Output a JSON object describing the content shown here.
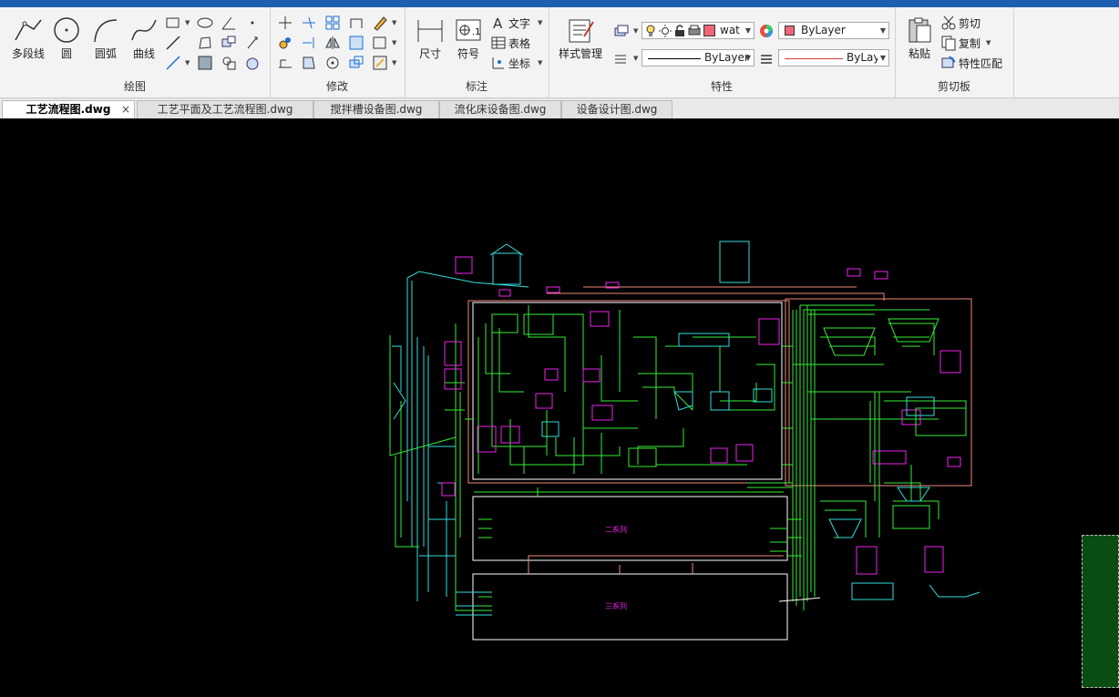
{
  "ribbon": {
    "groups": {
      "draw": {
        "label": "绘图",
        "polyline": "多段线",
        "circle": "圆",
        "arc": "圆弧",
        "curve": "曲线"
      },
      "modify": {
        "label": "修改"
      },
      "annotate": {
        "label": "标注",
        "dimension": "尺寸",
        "symbol": "符号",
        "text": "文字",
        "table": "表格",
        "coordinate": "坐标"
      },
      "properties": {
        "label": "特性",
        "style_manager": "样式管理",
        "layer_name": "wat",
        "color_value": "ByLayer",
        "linetype_value": "ByLayer",
        "lineweight_value": "ByLayer"
      },
      "clipboard": {
        "label": "剪切板",
        "paste": "粘贴",
        "cut": "剪切",
        "copy": "复制",
        "match_properties": "特性匹配"
      }
    }
  },
  "tabs": [
    {
      "label": "工艺流程图.dwg",
      "active": true,
      "close": "×"
    },
    {
      "label": "工艺平面及工艺流程图.dwg",
      "active": false
    },
    {
      "label": "搅拌槽设备图.dwg",
      "active": false
    },
    {
      "label": "流化床设备图.dwg",
      "active": false
    },
    {
      "label": "设备设计图.dwg",
      "active": false
    }
  ],
  "drawing": {
    "series_2_label": "二系列",
    "series_3_label": "三系列"
  },
  "colors": {
    "canvas_bg": "#000000",
    "green_line": "#33ee33",
    "magenta": "#ee22ee",
    "cyan": "#33dddd",
    "salmon": "#ee8877",
    "white": "#ffffff",
    "layer_color": "#ee6677",
    "selection_fill": "#0a4d12"
  }
}
